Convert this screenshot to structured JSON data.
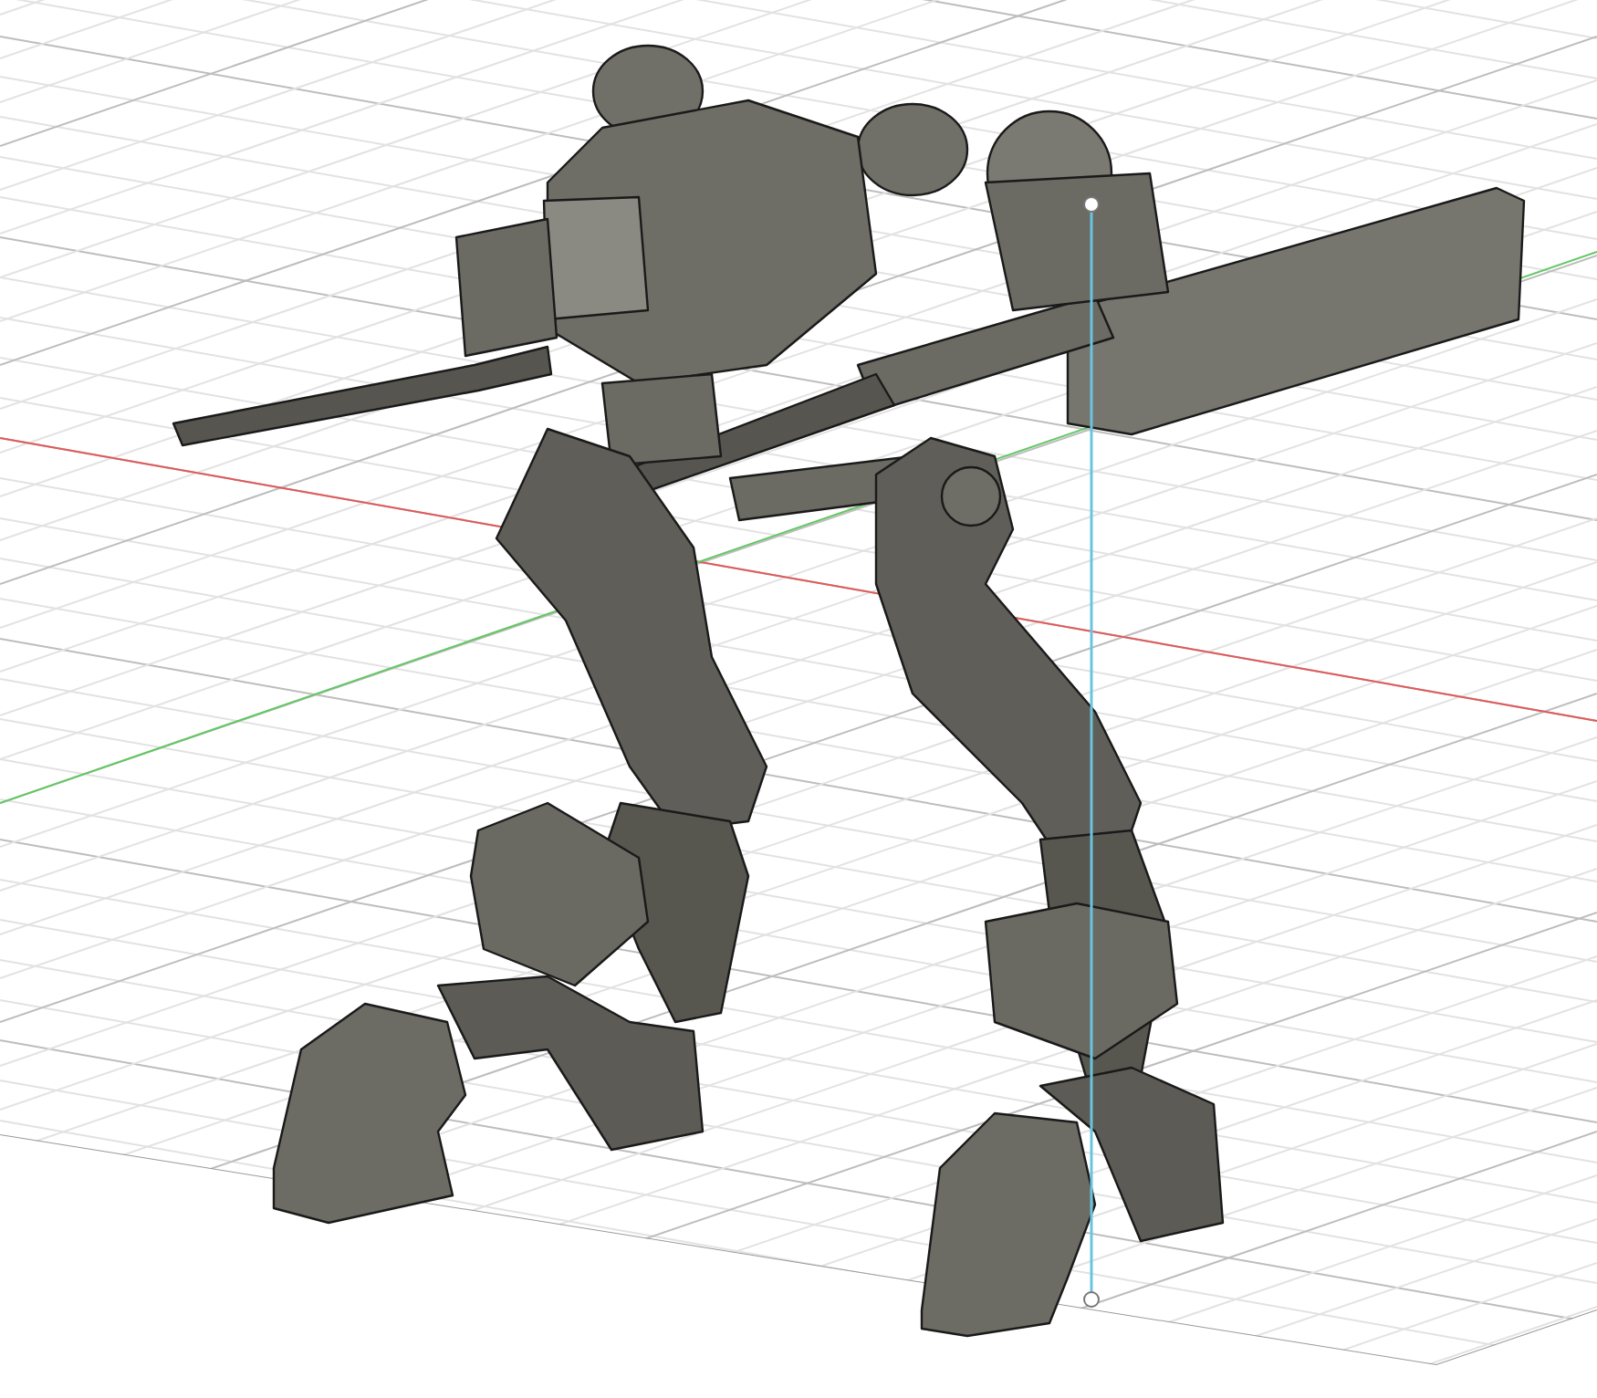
{
  "viewport": {
    "show_grid": true,
    "show_axes": true,
    "show_sketch_line": true
  }
}
